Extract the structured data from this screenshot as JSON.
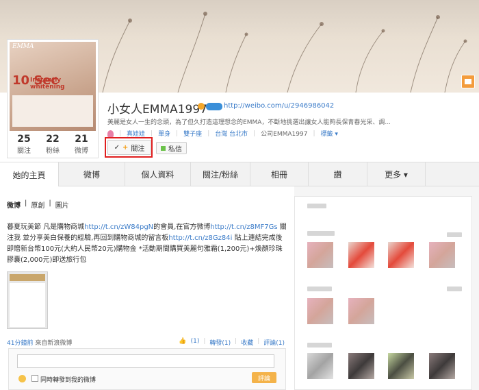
{
  "profile": {
    "name": "小女人EMMA1997",
    "url": "http://weibo.com/u/2946986042",
    "description": "美麗是女人一生的念頭，為了但久打造這理想念的EMMA，不斷地挑選出讓女人能夠長保青春光采、調...",
    "tags": [
      "真娃娃",
      "單身",
      "雙子座",
      "台灣 台北市",
      "公司EMMA1997",
      "標籤 ▾"
    ],
    "stats": [
      {
        "num": "25",
        "label": "關注"
      },
      {
        "num": "22",
        "label": "粉絲"
      },
      {
        "num": "21",
        "label": "微博"
      }
    ],
    "follow_check": "✓",
    "follow_label": "關注",
    "follow_plus": "+",
    "message_label": "私信",
    "avatar_logo": "EMMA",
    "avatar_big": "10 Sec",
    "avatar_sub": "Instantly whitening"
  },
  "tabs": [
    "她的主頁",
    "微博",
    "個人資料",
    "關注/粉絲",
    "相冊",
    "讚",
    "更多 ▾"
  ],
  "feed": {
    "subtabs": [
      "微博",
      "原創",
      "圖片"
    ],
    "post": {
      "text_parts": [
        {
          "t": "暮夏玩美節 凡是購物商城"
        },
        {
          "t": "http://t.cn/zW84pgN",
          "link": true
        },
        {
          "t": "的會員,在官方微博"
        },
        {
          "t": "http://t.cn/z8MF7Gs",
          "link": true
        },
        {
          "t": " 關注我 並分享美白保養的經驗,再回到購物商城的留言板"
        },
        {
          "t": "http://t.cn/z8Gz84i",
          "link": true
        },
        {
          "t": " 貼上連結完成後即贈新台幣100元(大約人民幣20元)購物金 *活動期間購買美麗句雅霜(1,200元)+煥顏珍珠膠囊(2,000元)即送旅行包"
        }
      ],
      "time": "41分鐘前",
      "source": "來自新浪微博",
      "likes": "(1)",
      "forward": "轉發(1)",
      "collect": "收藏",
      "comment": "評論(1)"
    },
    "comment_box": {
      "checkbox_label": "同時轉發到我的微博",
      "button": "評論"
    }
  }
}
